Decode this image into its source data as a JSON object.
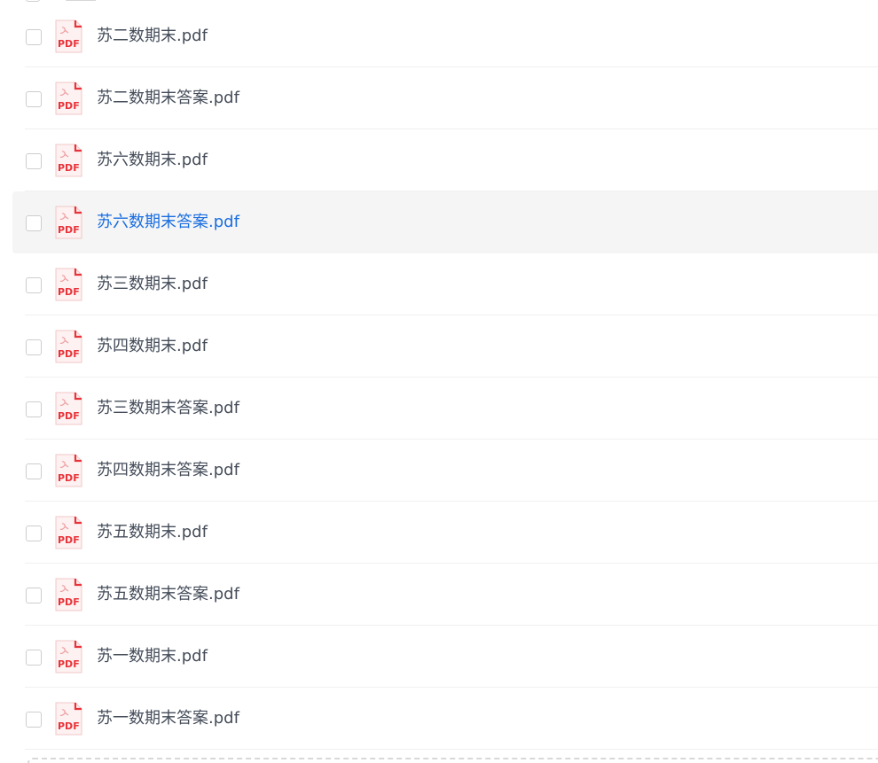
{
  "files": [
    {
      "name": "苏二数期末.pdf",
      "type": "PDF",
      "hovered": false
    },
    {
      "name": "苏二数期末答案.pdf",
      "type": "PDF",
      "hovered": false
    },
    {
      "name": "苏六数期末.pdf",
      "type": "PDF",
      "hovered": false
    },
    {
      "name": "苏六数期末答案.pdf",
      "type": "PDF",
      "hovered": true
    },
    {
      "name": "苏三数期末.pdf",
      "type": "PDF",
      "hovered": false
    },
    {
      "name": "苏四数期末.pdf",
      "type": "PDF",
      "hovered": false
    },
    {
      "name": "苏三数期末答案.pdf",
      "type": "PDF",
      "hovered": false
    },
    {
      "name": "苏四数期末答案.pdf",
      "type": "PDF",
      "hovered": false
    },
    {
      "name": "苏五数期末.pdf",
      "type": "PDF",
      "hovered": false
    },
    {
      "name": "苏五数期末答案.pdf",
      "type": "PDF",
      "hovered": false
    },
    {
      "name": "苏一数期末.pdf",
      "type": "PDF",
      "hovered": false
    },
    {
      "name": "苏一数期末答案.pdf",
      "type": "PDF",
      "hovered": false
    }
  ],
  "colors": {
    "hover_text": "#1a6ee0",
    "text": "#454d5a",
    "pdf_red": "#e8333a",
    "pdf_fold": "#e8333a",
    "pdf_bg": "#fdeeee"
  },
  "icons": {
    "file": "pdf-file-icon",
    "checkbox": "checkbox-unchecked"
  }
}
